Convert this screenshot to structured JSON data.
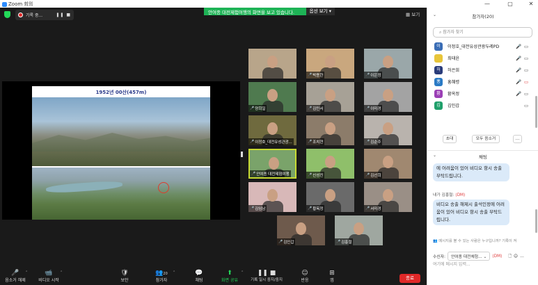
{
  "window": {
    "title": "Zoom 회의",
    "controls": [
      "—",
      "▢",
      "✕"
    ]
  },
  "meeting": {
    "recording_label": "기록 중...",
    "recording_controls": "❚❚ ■",
    "banner_message": "안여종 대전제험여행의 화면을 보고 있습니다.",
    "banner_option": "옵션 보기 ▾",
    "view_label": "▦ 보기",
    "slide_title": "1952년 00산(457m)"
  },
  "gallery": [
    {
      "name": "",
      "color": "#b8a58a"
    },
    {
      "name": "박용한",
      "color": "#c9a77e"
    },
    {
      "name": "이은정",
      "color": "#9aa7a9"
    },
    {
      "name": "양희일",
      "color": "#4f7a4f"
    },
    {
      "name": "김민서",
      "color": "#a7a196"
    },
    {
      "name": "이미경",
      "color": "#a3a3a3"
    },
    {
      "name": "이정호_대전유성관광...",
      "color": "#6f6a3e"
    },
    {
      "name": "조치현",
      "color": "#8c7c6a"
    },
    {
      "name": "김순주",
      "color": "#b9b3ad"
    },
    {
      "name": "안여종 대전제험여행",
      "color": "#7aa36a",
      "active": true
    },
    {
      "name": "신성진",
      "color": "#8fbf6a"
    },
    {
      "name": "김선희",
      "color": "#a08870"
    },
    {
      "name": "김임남",
      "color": "#d8b8b8"
    },
    {
      "name": "황옥정",
      "color": "#6a6a6a"
    },
    {
      "name": "서미경",
      "color": "#9a8f86"
    },
    {
      "name": "김인갑",
      "color": "#6e5a4c"
    },
    {
      "name": "김홍철",
      "color": "#9fa7a0"
    }
  ],
  "toolbar": {
    "items": [
      {
        "label": "음소거 해제",
        "icon": "🎤"
      },
      {
        "label": "비디오 시작",
        "icon": "📹"
      },
      {
        "label": "보안",
        "icon": "🛡"
      },
      {
        "label": "참가자",
        "icon": "👥",
        "count": "20"
      },
      {
        "label": "채팅",
        "icon": "💬"
      },
      {
        "label": "화면 공유",
        "icon": "⬆"
      },
      {
        "label": "기록 일시 중지/중지",
        "icon": "❚❚ ■"
      },
      {
        "label": "반응",
        "icon": "☺"
      },
      {
        "label": "앱",
        "icon": "⊞"
      }
    ],
    "end_label": "종료"
  },
  "participants_panel": {
    "title": "참가자(20)",
    "search_placeholder": "참가자 찾기",
    "participants": [
      {
        "initial": "이",
        "name": "이정호_대전유성관광두레PD",
        "color": "#3a6db5",
        "mic": "off",
        "video": "on"
      },
      {
        "initial": "",
        "name": "최태윤",
        "color": "#e8c53a",
        "mic": "off",
        "video": "on"
      },
      {
        "initial": "허",
        "name": "허은희",
        "color": "#2a3c7a",
        "mic": "off",
        "video": "on"
      },
      {
        "initial": "홍",
        "name": "홍혜령",
        "color": "#2a7ac5",
        "mic": "off",
        "video": "off"
      },
      {
        "initial": "황",
        "name": "황옥정",
        "color": "#9b3fb5",
        "mic": "off",
        "video": "on"
      },
      {
        "initial": "김",
        "name": "김인갑",
        "color": "#1f9f6a",
        "mic": "",
        "video": "on"
      }
    ],
    "invite_label": "초대",
    "mute_all_label": "모두 음소거",
    "more_label": "..."
  },
  "chat": {
    "title": "채팅",
    "bubble1": "에 어려움이 있어 비디오 항시 송출 부탁드립니다.",
    "sender": "내가 김홍철:",
    "sender_tag": "(DM)",
    "bubble2": "비디오 송출 해제시 출석인정에 어려움이 있어 비디오 항시 송출 부탁드립니다.",
    "info": "메시지를 볼 수 있는 사람은 누구입니까? 기록이 켜",
    "recipient_label": "수신자:",
    "recipient": "안여종 대전체험...",
    "recipient_tag": "(DM)",
    "input_placeholder": "여기에 메시지 입력..."
  }
}
